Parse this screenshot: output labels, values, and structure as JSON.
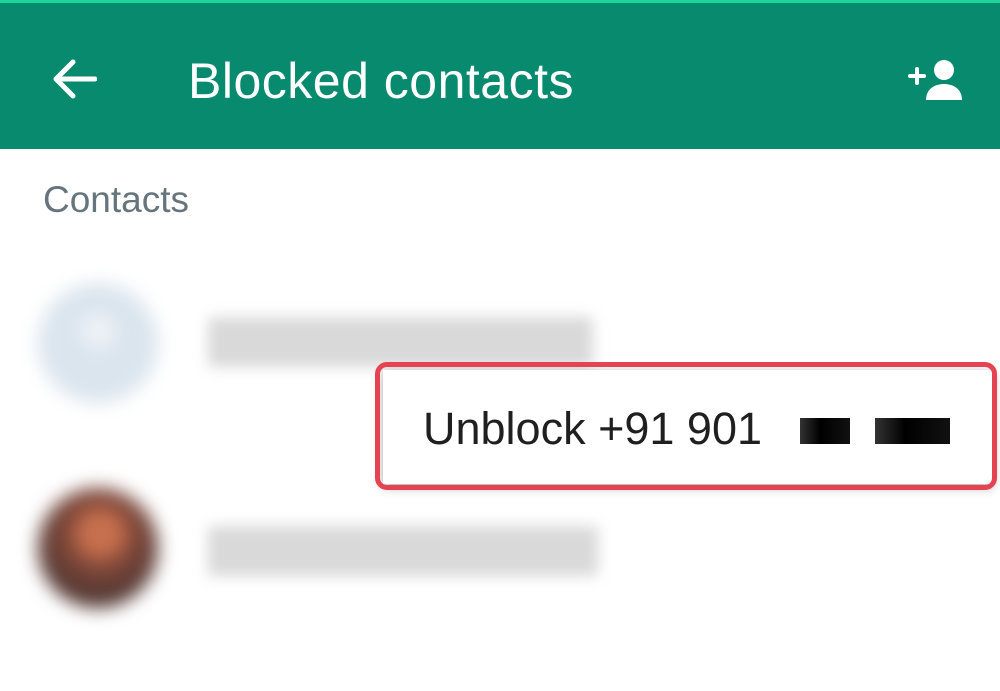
{
  "appbar": {
    "title": "Blocked contacts",
    "back_icon": "arrow-back-icon",
    "add_icon": "add-person-icon",
    "color": "#078A6E"
  },
  "section": {
    "header": "Contacts"
  },
  "contacts": [
    {
      "avatar": "default-avatar",
      "name_visible": false
    },
    {
      "avatar": "photo-avatar",
      "name_visible": false
    }
  ],
  "popup": {
    "action_label": "Unblock +91 901",
    "highlight_color": "#e64352"
  }
}
